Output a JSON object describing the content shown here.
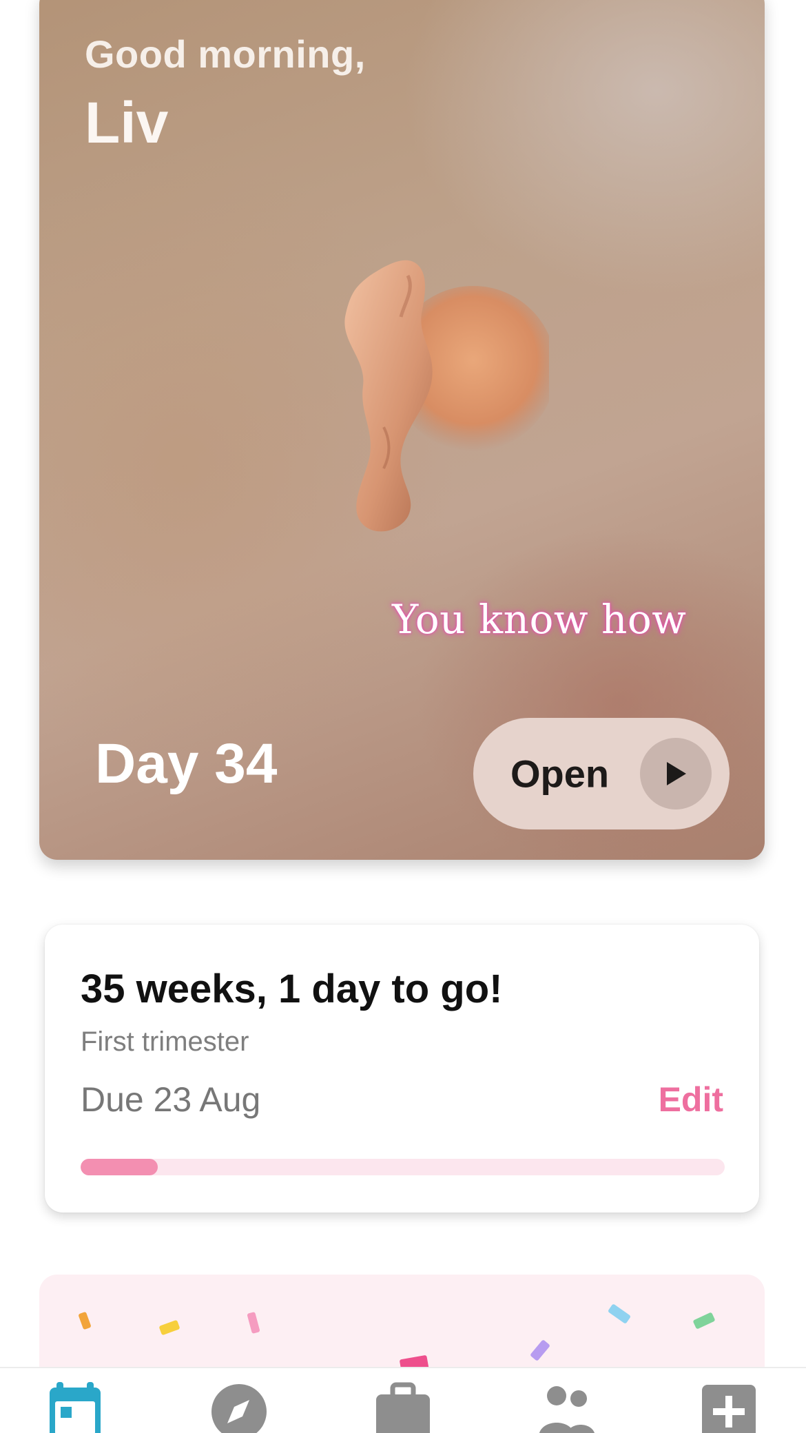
{
  "hero": {
    "greeting": "Good morning,",
    "name": "Liv",
    "caption": "You know how",
    "day_label": "Day 34",
    "open_label": "Open"
  },
  "pregnancy": {
    "title": "35 weeks, 1 day to go!",
    "trimester": "First trimester",
    "due": "Due 23 Aug",
    "edit_label": "Edit",
    "progress": 0.12,
    "colors": {
      "progress": "#f38fb1",
      "track": "#fce6ee",
      "edit": "#ee6f9f"
    }
  },
  "nav": {
    "items": [
      {
        "name": "calendar-icon",
        "active": true
      },
      {
        "name": "compass-icon",
        "active": false
      },
      {
        "name": "briefcase-icon",
        "active": false
      },
      {
        "name": "people-icon",
        "active": false
      },
      {
        "name": "plus-square-icon",
        "active": false
      }
    ],
    "colors": {
      "active": "#2aa7c9",
      "inactive": "#8e8e8e"
    }
  }
}
